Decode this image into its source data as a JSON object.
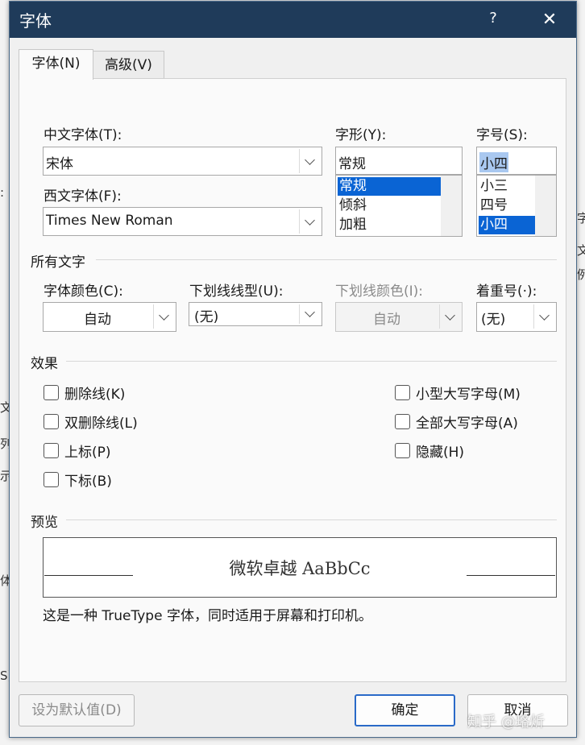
{
  "title": "字体",
  "help_glyph": "?",
  "close_glyph": "✕",
  "tabs": [
    {
      "label": "字体(N)"
    },
    {
      "label": "高级(V)"
    }
  ],
  "chinese_font": {
    "label": "中文字体(T):",
    "value": "宋体"
  },
  "western_font": {
    "label": "西文字体(F):",
    "value": "Times New Roman"
  },
  "style": {
    "label": "字形(Y):",
    "value": "常规",
    "options": [
      "常规",
      "倾斜",
      "加粗"
    ],
    "selected_index": 0
  },
  "size": {
    "label": "字号(S):",
    "value": "小四",
    "options": [
      "小三",
      "四号",
      "小四"
    ],
    "selected_index": 2
  },
  "all_text": {
    "title": "所有文字",
    "font_color": {
      "label": "字体颜色(C):",
      "value": "自动"
    },
    "underline_style": {
      "label": "下划线线型(U):",
      "value": "(无)"
    },
    "underline_color": {
      "label": "下划线颜色(I):",
      "value": "自动"
    },
    "emphasis": {
      "label": "着重号(·):",
      "value": "(无)"
    }
  },
  "effects": {
    "title": "效果",
    "left": [
      "删除线(K)",
      "双删除线(L)",
      "上标(P)",
      "下标(B)"
    ],
    "right": [
      "小型大写字母(M)",
      "全部大写字母(A)",
      "隐藏(H)"
    ]
  },
  "preview": {
    "title": "预览",
    "sample": "微软卓越  AaBbCc",
    "description": "这是一种 TrueType 字体，同时适用于屏幕和打印机。"
  },
  "buttons": {
    "set_default": "设为默认值(D)",
    "ok": "确定",
    "cancel": "取消"
  },
  "watermark": "知乎 @珞炘"
}
